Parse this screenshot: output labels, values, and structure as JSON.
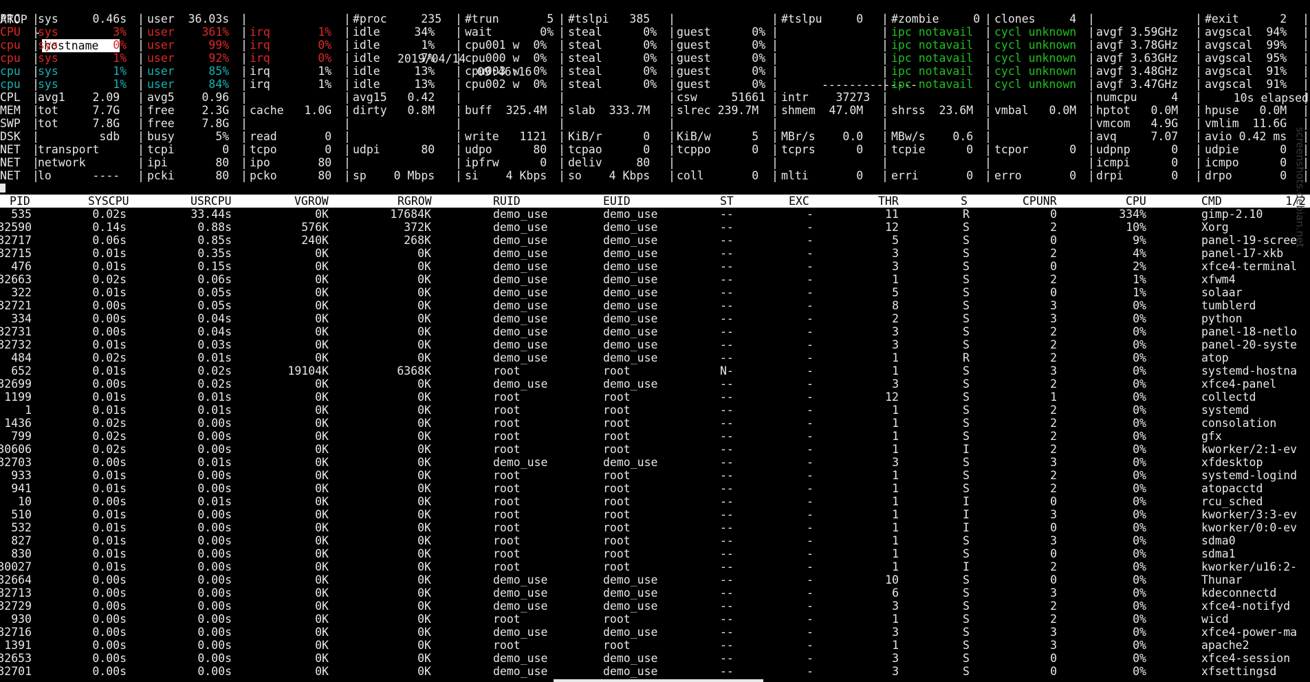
{
  "header": {
    "app": "ATOP",
    "dash": "-",
    "hostname": "hostname",
    "date": "2019/04/14",
    "time": "09:46:16",
    "dashes": "--------------",
    "elapsed": "10s elapsed"
  },
  "colors": {
    "red": "#e02828",
    "cyan": "#18b2b2",
    "green": "#20c020",
    "text": "#e8e8e8"
  },
  "sysrows": [
    {
      "label": "PRC",
      "c": [
        "sys     0.46s",
        "user  36.03s",
        "",
        "#proc     235",
        "#trun       5",
        "#tslpi   385",
        "",
        "#tslpu     0",
        "#zombie     0",
        "clones     4",
        "",
        "#exit      2"
      ]
    },
    {
      "label": "CPU",
      "c": [
        "sys        3%",
        "user    361%",
        "irq       1%",
        "idle     34%",
        "wait       0%",
        "steal      0%",
        "guest      0%",
        "",
        "ipc notavail",
        "cycl unknown",
        "avgf 3.59GHz",
        "avgscal  94%"
      ],
      "color": "red"
    },
    {
      "label": "cpu",
      "c": [
        "sys        0%",
        "user     99%",
        "irq       0%",
        "idle      1%",
        "cpu001 w  0%",
        "steal      0%",
        "guest      0%",
        "",
        "ipc notavail",
        "cycl unknown",
        "avgf 3.78GHz",
        "avgscal  99%"
      ],
      "color": "red"
    },
    {
      "label": "cpu",
      "c": [
        "sys        1%",
        "user     92%",
        "irq       0%",
        "idle      7%",
        "cpu000 w  0%",
        "steal      0%",
        "guest      0%",
        "",
        "ipc notavail",
        "cycl unknown",
        "avgf 3.63GHz",
        "avgscal  95%"
      ],
      "color": "red"
    },
    {
      "label": "cpu",
      "c": [
        "sys        1%",
        "user     85%",
        "irq       1%",
        "idle     13%",
        "cpu003 w  0%",
        "steal      0%",
        "guest      0%",
        "",
        "ipc notavail",
        "cycl unknown",
        "avgf 3.48GHz",
        "avgscal  91%"
      ],
      "color": "cyan"
    },
    {
      "label": "cpu",
      "c": [
        "sys        1%",
        "user     84%",
        "irq       1%",
        "idle     13%",
        "cpu002 w  0%",
        "steal      0%",
        "guest      0%",
        "",
        "ipc notavail",
        "cycl unknown",
        "avgf 3.47GHz",
        "avgscal  91%"
      ],
      "color": "cyan"
    },
    {
      "label": "CPL",
      "c": [
        "avg1    2.09",
        "avg5    0.96",
        "",
        "avg15   0.42",
        "",
        "",
        "csw     51661",
        "intr    37273",
        "",
        "",
        "numcpu     4",
        ""
      ]
    },
    {
      "label": "MEM",
      "c": [
        "tot     7.7G",
        "free    2.3G",
        "cache   1.0G",
        "dirty   0.8M",
        "buff  325.4M",
        "slab  333.7M",
        "slrec 239.7M",
        "shmem  47.0M",
        "shrss  23.6M",
        "vmbal   0.0M",
        "hptot   0.0M",
        "hpuse   0.0M"
      ]
    },
    {
      "label": "SWP",
      "c": [
        "tot     7.8G",
        "free    7.8G",
        "",
        "",
        "",
        "",
        "",
        "",
        "",
        "",
        "vmcom   4.9G",
        "vmlim  11.6G"
      ]
    },
    {
      "label": "DSK",
      "c": [
        "         sdb",
        "busy      5%",
        "read       0",
        "",
        "write   1121",
        "KiB/r      0",
        "KiB/w      5",
        "MBr/s    0.0",
        "MBw/s    0.6",
        "",
        "avq     7.07",
        "avio 0.42 ms"
      ]
    },
    {
      "label": "NET",
      "c": [
        "transport",
        "tcpi       0",
        "tcpo       0",
        "udpi      80",
        "udpo      80",
        "tcpao      0",
        "tcppo      0",
        "tcprs      0",
        "tcpie      0",
        "tcpor      0",
        "udpnp      0",
        "udpie      0"
      ]
    },
    {
      "label": "NET",
      "c": [
        "network",
        "ipi       80",
        "ipo       80",
        "",
        "ipfrw      0",
        "deliv     80",
        "",
        "",
        "",
        "",
        "icmpi      0",
        "icmpo      0"
      ]
    },
    {
      "label": "NET",
      "c": [
        "lo      ----",
        "pcki      80",
        "pcko      80",
        "sp    0 Mbps",
        "si    4 Kbps",
        "so    4 Kbps",
        "coll       0",
        "mlti       0",
        "erri       0",
        "erro       0",
        "drpi       0",
        "drpo       0"
      ]
    }
  ],
  "table": {
    "page": "1/2",
    "columns": [
      "PID",
      "SYSCPU",
      "USRCPU",
      "VGROW",
      "RGROW",
      "RUID",
      "EUID",
      "ST",
      "EXC",
      "THR",
      "S",
      "CPUNR",
      "CPU",
      "CMD"
    ],
    "rows": [
      [
        "535",
        "0.02s",
        "33.44s",
        "0K",
        "17684K",
        "demo_use",
        "demo_use",
        "--",
        "-",
        "11",
        "R",
        "0",
        "334%",
        "gimp-2.10"
      ],
      [
        "32590",
        "0.14s",
        "0.88s",
        "576K",
        "372K",
        "demo_use",
        "demo_use",
        "--",
        "-",
        "12",
        "S",
        "2",
        "10%",
        "Xorg"
      ],
      [
        "32717",
        "0.06s",
        "0.85s",
        "240K",
        "268K",
        "demo_use",
        "demo_use",
        "--",
        "-",
        "5",
        "S",
        "0",
        "9%",
        "panel-19-scree"
      ],
      [
        "32715",
        "0.01s",
        "0.35s",
        "0K",
        "0K",
        "demo_use",
        "demo_use",
        "--",
        "-",
        "3",
        "S",
        "2",
        "4%",
        "panel-17-xkb"
      ],
      [
        "476",
        "0.01s",
        "0.15s",
        "0K",
        "0K",
        "demo_use",
        "demo_use",
        "--",
        "-",
        "3",
        "S",
        "0",
        "2%",
        "xfce4-terminal"
      ],
      [
        "32663",
        "0.02s",
        "0.06s",
        "0K",
        "0K",
        "demo_use",
        "demo_use",
        "--",
        "-",
        "1",
        "S",
        "2",
        "1%",
        "xfwm4"
      ],
      [
        "322",
        "0.01s",
        "0.05s",
        "0K",
        "0K",
        "demo_use",
        "demo_use",
        "--",
        "-",
        "5",
        "S",
        "0",
        "1%",
        "solaar"
      ],
      [
        "32721",
        "0.00s",
        "0.05s",
        "0K",
        "0K",
        "demo_use",
        "demo_use",
        "--",
        "-",
        "8",
        "S",
        "3",
        "0%",
        "tumblerd"
      ],
      [
        "334",
        "0.00s",
        "0.04s",
        "0K",
        "0K",
        "demo_use",
        "demo_use",
        "--",
        "-",
        "2",
        "S",
        "3",
        "0%",
        "python"
      ],
      [
        "32731",
        "0.00s",
        "0.04s",
        "0K",
        "0K",
        "demo_use",
        "demo_use",
        "--",
        "-",
        "3",
        "S",
        "2",
        "0%",
        "panel-18-netlo"
      ],
      [
        "32732",
        "0.01s",
        "0.03s",
        "0K",
        "0K",
        "demo_use",
        "demo_use",
        "--",
        "-",
        "3",
        "S",
        "2",
        "0%",
        "panel-20-syste"
      ],
      [
        "484",
        "0.02s",
        "0.01s",
        "0K",
        "0K",
        "demo_use",
        "demo_use",
        "--",
        "-",
        "1",
        "R",
        "2",
        "0%",
        "atop"
      ],
      [
        "652",
        "0.01s",
        "0.02s",
        "19104K",
        "6368K",
        "root",
        "root",
        "N-",
        "-",
        "1",
        "S",
        "3",
        "0%",
        "systemd-hostna"
      ],
      [
        "32699",
        "0.00s",
        "0.02s",
        "0K",
        "0K",
        "demo_use",
        "demo_use",
        "--",
        "-",
        "3",
        "S",
        "2",
        "0%",
        "xfce4-panel"
      ],
      [
        "1199",
        "0.01s",
        "0.01s",
        "0K",
        "0K",
        "root",
        "root",
        "--",
        "-",
        "12",
        "S",
        "1",
        "0%",
        "collectd"
      ],
      [
        "1",
        "0.01s",
        "0.01s",
        "0K",
        "0K",
        "root",
        "root",
        "--",
        "-",
        "1",
        "S",
        "2",
        "0%",
        "systemd"
      ],
      [
        "1436",
        "0.02s",
        "0.00s",
        "0K",
        "0K",
        "root",
        "root",
        "--",
        "-",
        "1",
        "S",
        "2",
        "0%",
        "consolation"
      ],
      [
        "799",
        "0.02s",
        "0.00s",
        "0K",
        "0K",
        "root",
        "root",
        "--",
        "-",
        "1",
        "S",
        "2",
        "0%",
        "gfx"
      ],
      [
        "30606",
        "0.02s",
        "0.00s",
        "0K",
        "0K",
        "root",
        "root",
        "--",
        "-",
        "1",
        "I",
        "2",
        "0%",
        "kworker/2:1-ev"
      ],
      [
        "32703",
        "0.00s",
        "0.01s",
        "0K",
        "0K",
        "demo_use",
        "demo_use",
        "--",
        "-",
        "3",
        "S",
        "3",
        "0%",
        "xfdesktop"
      ],
      [
        "933",
        "0.01s",
        "0.00s",
        "0K",
        "0K",
        "root",
        "root",
        "--",
        "-",
        "1",
        "S",
        "2",
        "0%",
        "systemd-logind"
      ],
      [
        "941",
        "0.01s",
        "0.00s",
        "0K",
        "0K",
        "root",
        "root",
        "--",
        "-",
        "1",
        "S",
        "2",
        "0%",
        "atopacctd"
      ],
      [
        "10",
        "0.00s",
        "0.01s",
        "0K",
        "0K",
        "root",
        "root",
        "--",
        "-",
        "1",
        "I",
        "0",
        "0%",
        "rcu_sched"
      ],
      [
        "510",
        "0.01s",
        "0.00s",
        "0K",
        "0K",
        "root",
        "root",
        "--",
        "-",
        "1",
        "I",
        "3",
        "0%",
        "kworker/3:3-ev"
      ],
      [
        "532",
        "0.01s",
        "0.00s",
        "0K",
        "0K",
        "root",
        "root",
        "--",
        "-",
        "1",
        "I",
        "0",
        "0%",
        "kworker/0:0-ev"
      ],
      [
        "827",
        "0.01s",
        "0.00s",
        "0K",
        "0K",
        "root",
        "root",
        "--",
        "-",
        "1",
        "S",
        "3",
        "0%",
        "sdma0"
      ],
      [
        "830",
        "0.01s",
        "0.00s",
        "0K",
        "0K",
        "root",
        "root",
        "--",
        "-",
        "1",
        "S",
        "0",
        "0%",
        "sdma1"
      ],
      [
        "30027",
        "0.01s",
        "0.00s",
        "0K",
        "0K",
        "root",
        "root",
        "--",
        "-",
        "1",
        "I",
        "2",
        "0%",
        "kworker/u16:2-"
      ],
      [
        "32664",
        "0.00s",
        "0.00s",
        "0K",
        "0K",
        "demo_use",
        "demo_use",
        "--",
        "-",
        "10",
        "S",
        "0",
        "0%",
        "Thunar"
      ],
      [
        "32713",
        "0.00s",
        "0.00s",
        "0K",
        "0K",
        "demo_use",
        "demo_use",
        "--",
        "-",
        "6",
        "S",
        "3",
        "0%",
        "kdeconnectd"
      ],
      [
        "32729",
        "0.00s",
        "0.00s",
        "0K",
        "0K",
        "demo_use",
        "demo_use",
        "--",
        "-",
        "3",
        "S",
        "2",
        "0%",
        "xfce4-notifyd"
      ],
      [
        "930",
        "0.00s",
        "0.00s",
        "0K",
        "0K",
        "root",
        "root",
        "--",
        "-",
        "1",
        "S",
        "2",
        "0%",
        "wicd"
      ],
      [
        "32716",
        "0.00s",
        "0.00s",
        "0K",
        "0K",
        "demo_use",
        "demo_use",
        "--",
        "-",
        "3",
        "S",
        "3",
        "0%",
        "xfce4-power-ma"
      ],
      [
        "1391",
        "0.00s",
        "0.00s",
        "0K",
        "0K",
        "root",
        "root",
        "--",
        "-",
        "1",
        "S",
        "3",
        "0%",
        "apache2"
      ],
      [
        "32653",
        "0.00s",
        "0.00s",
        "0K",
        "0K",
        "demo_use",
        "demo_use",
        "--",
        "-",
        "3",
        "S",
        "0",
        "0%",
        "xfce4-session"
      ],
      [
        "32701",
        "0.00s",
        "0.00s",
        "0K",
        "0K",
        "demo_use",
        "demo_use",
        "--",
        "-",
        "3",
        "S",
        "0",
        "0%",
        "xfsettingsd"
      ]
    ]
  },
  "watermark": "screenshots.debian.net"
}
